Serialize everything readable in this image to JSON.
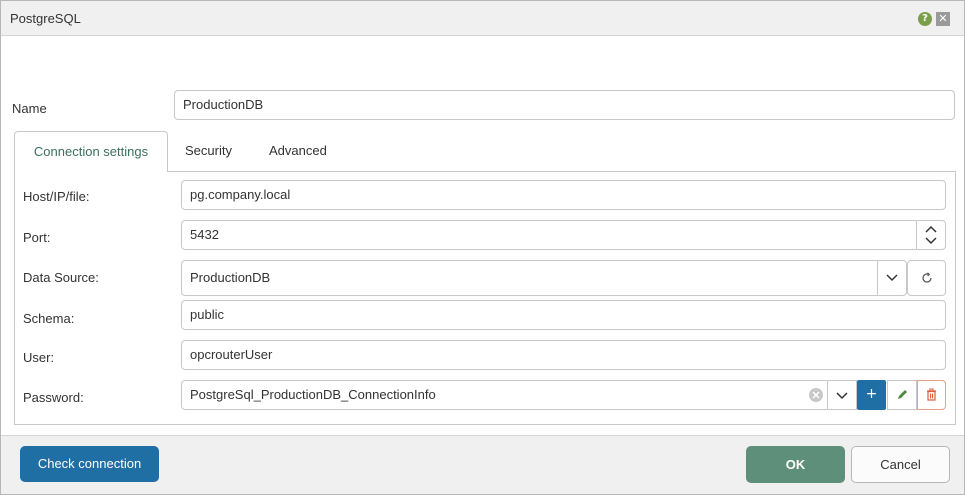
{
  "window": {
    "title": "PostgreSQL",
    "help_icon": "question-mark-icon",
    "help_glyph": "?",
    "close_icon": "close-icon",
    "close_glyph": "✕"
  },
  "name_field": {
    "label": "Name",
    "value": "ProductionDB"
  },
  "tabs": [
    {
      "label": "Connection settings",
      "active": true
    },
    {
      "label": "Security",
      "active": false
    },
    {
      "label": "Advanced",
      "active": false
    }
  ],
  "connection": {
    "host": {
      "label": "Host/IP/file:",
      "value": "pg.company.local"
    },
    "port": {
      "label": "Port:",
      "value": "5432"
    },
    "data_source": {
      "label": "Data Source:",
      "value": "ProductionDB"
    },
    "schema": {
      "label": "Schema:",
      "value": "public"
    },
    "user": {
      "label": "User:",
      "value": "opcrouterUser"
    },
    "password": {
      "label": "Password:",
      "value": "PostgreSql_ProductionDB_ConnectionInfo"
    }
  },
  "password_actions": {
    "add_glyph": "+"
  },
  "footer": {
    "check_label": "Check connection",
    "ok_label": "OK",
    "cancel_label": "Cancel"
  },
  "colors": {
    "primary_blue": "#1f6fa5",
    "ok_green": "#5e8f7a",
    "active_tab_text": "#3b6f5f",
    "delete_red": "#e05a3a",
    "edit_green": "#4a8a3c"
  }
}
